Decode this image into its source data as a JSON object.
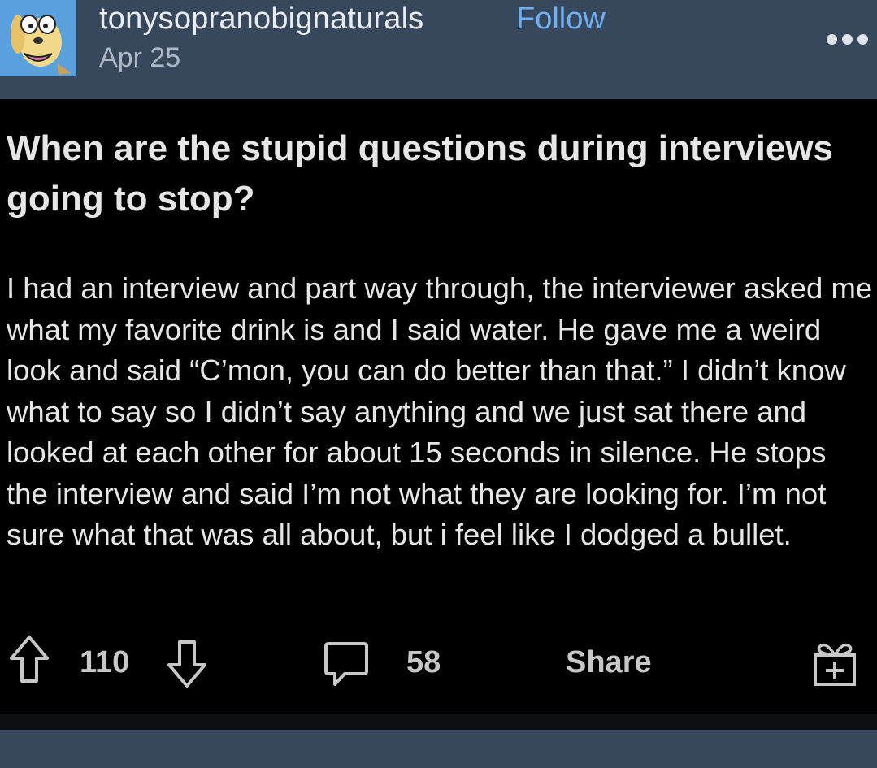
{
  "header": {
    "username": "tonysopranobignaturals",
    "follow_label": "Follow",
    "date": "Apr 25"
  },
  "post": {
    "title": "When are the stupid questions during interviews going to stop?",
    "body": "I had an interview and part way through, the interviewer asked me what my favorite drink is and I said water. He gave me a weird look and said “C’mon, you can do better than that.” I didn’t know what to say so I didn’t say anything and we just sat there and looked at each other for about 15 seconds in silence. He stops the interview and said I’m not what they are looking for. I’m not sure what that was all about, but i feel like I dodged a bullet."
  },
  "actions": {
    "upvote_count": "110",
    "comment_count": "58",
    "share_label": "Share"
  },
  "icons": {
    "avatar": "cartoon-dog-avatar",
    "more": "more-options-icon",
    "upvote": "upvote-arrow-icon",
    "downvote": "downvote-arrow-icon",
    "comment": "comment-bubble-icon",
    "gift": "gift-award-icon"
  },
  "colors": {
    "header_bg": "#37475c",
    "post_bg": "#000000",
    "follow": "#6fb0f5",
    "text": "#e6e6e6"
  }
}
